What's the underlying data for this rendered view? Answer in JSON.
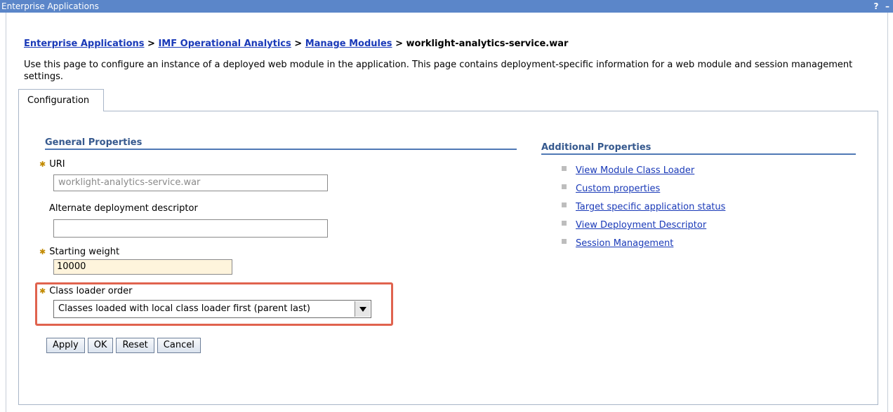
{
  "window": {
    "title": "Enterprise Applications",
    "help_icon": "?",
    "minimize_icon": "–"
  },
  "breadcrumb": {
    "items": [
      "Enterprise Applications",
      "IMF Operational Analytics",
      "Manage Modules"
    ],
    "separator": ">",
    "current": "worklight-analytics-service.war"
  },
  "description": "Use this page to configure an instance of a deployed web module in the application. This page contains deployment-specific information for a web module and session management settings.",
  "tabs": [
    {
      "label": "Configuration"
    }
  ],
  "general": {
    "heading": "General Properties",
    "required_marker": "✱",
    "uri": {
      "label": "URI",
      "value": "worklight-analytics-service.war"
    },
    "alt_descriptor": {
      "label": "Alternate deployment descriptor",
      "value": ""
    },
    "starting_weight": {
      "label": "Starting weight",
      "value": "10000"
    },
    "class_loader": {
      "label": "Class loader order",
      "value": "Classes loaded with local class loader first (parent last)"
    }
  },
  "buttons": {
    "apply": "Apply",
    "ok": "OK",
    "reset": "Reset",
    "cancel": "Cancel"
  },
  "additional": {
    "heading": "Additional Properties",
    "links": [
      "View Module Class Loader",
      "Custom properties",
      "Target specific application status",
      "View Deployment Descriptor",
      "Session Management"
    ]
  },
  "colors": {
    "titlebar": "#5b86c9",
    "link": "#1a3ab8",
    "section_heading": "#36598e",
    "highlight": "#e0634e",
    "input_required_bg": "#fef4dc"
  }
}
